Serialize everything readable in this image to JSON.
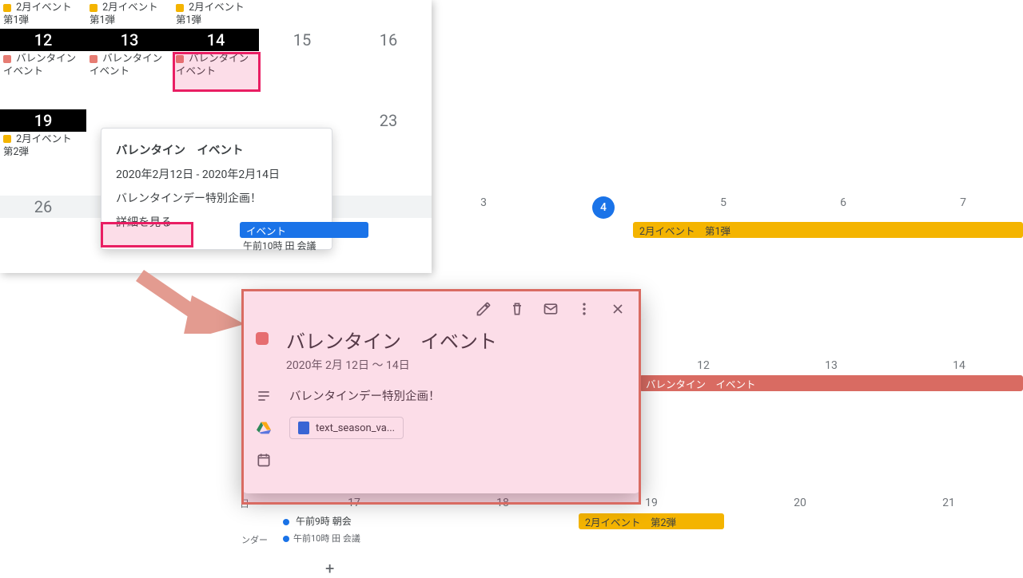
{
  "mini": {
    "row0_event": "2月イベント　第1弾",
    "dates1": [
      "12",
      "13",
      "14",
      "15",
      "16"
    ],
    "valentine_event_short": "バレンタイン　イベント",
    "dates2": [
      "19",
      "",
      "",
      "",
      "23"
    ],
    "feb_event2": "2月イベント　第2弾",
    "dates3": [
      "26",
      "",
      "",
      "",
      ""
    ]
  },
  "tooltip": {
    "title": "バレンタイン　イベント",
    "range": "2020年2月12日 - 2020年2月14日",
    "desc": "バレンタインデー特別企画！",
    "detail": "詳細を見る"
  },
  "big": {
    "row1_dates": [
      "3",
      "4",
      "5",
      "6",
      "7"
    ],
    "today_index": 1,
    "row1_event_blue": "イベント",
    "row1_event_amber": "2月イベント　第1弾",
    "row1_meeting": "午前10時 田 会議",
    "row2_dates": [
      "12",
      "13",
      "14"
    ],
    "row2_event_salmon": "バレンタイン　イベント",
    "row3_partial_day": "日",
    "row3_dates": [
      "17",
      "18",
      "19",
      "20",
      "21"
    ],
    "row3_morning": "午前9時 朝会",
    "row3_event_amber": "2月イベント　第2弾",
    "row3_meeting2": "午前10時 田 会議",
    "calendar_label": "ンダー"
  },
  "card": {
    "title": "バレンタイン　イベント",
    "range": "2020年 2月 12日 〜 14日",
    "desc": "バレンタインデー特別企画！",
    "attachment": "text_season_va..."
  },
  "icons": {
    "edit": "edit-icon",
    "trash": "trash-icon",
    "mail": "mail-icon",
    "more": "more-icon",
    "close": "close-icon",
    "notes": "notes-icon",
    "drive": "drive-icon",
    "cal": "calendar-icon",
    "plus": "+"
  }
}
